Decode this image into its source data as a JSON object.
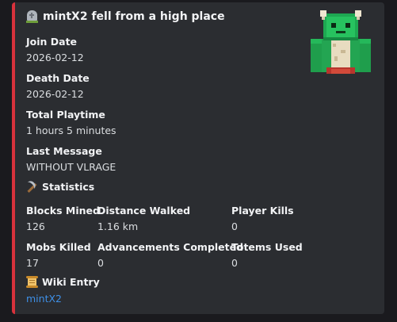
{
  "embed": {
    "accent_color": "#d8323c",
    "title_icon": "headstone-icon",
    "title": "mintX2 fell from a high place"
  },
  "fields": {
    "join_date": {
      "name": "Join Date",
      "value": "2026-02-12"
    },
    "death_date": {
      "name": "Death Date",
      "value": "2026-02-12"
    },
    "total_playtime": {
      "name": "Total Playtime",
      "value": "1 hours 5 minutes"
    },
    "last_message": {
      "name": "Last Message",
      "value": "WITHOUT VLRAGE"
    }
  },
  "statistics": {
    "icon": "pickaxe-icon",
    "label": "Statistics",
    "items": [
      {
        "name": "Blocks Mined",
        "value": "126"
      },
      {
        "name": "Distance Walked",
        "value": "1.16 km"
      },
      {
        "name": "Player Kills",
        "value": "0"
      },
      {
        "name": "Mobs Killed",
        "value": "17"
      },
      {
        "name": "Advancements Completed",
        "value": "0"
      },
      {
        "name": "Totems Used",
        "value": "0"
      }
    ]
  },
  "wiki": {
    "icon": "scroll-icon",
    "label": "Wiki Entry",
    "link_text": "mintX2"
  },
  "thumbnail": {
    "description": "player-skin-thumbnail"
  }
}
